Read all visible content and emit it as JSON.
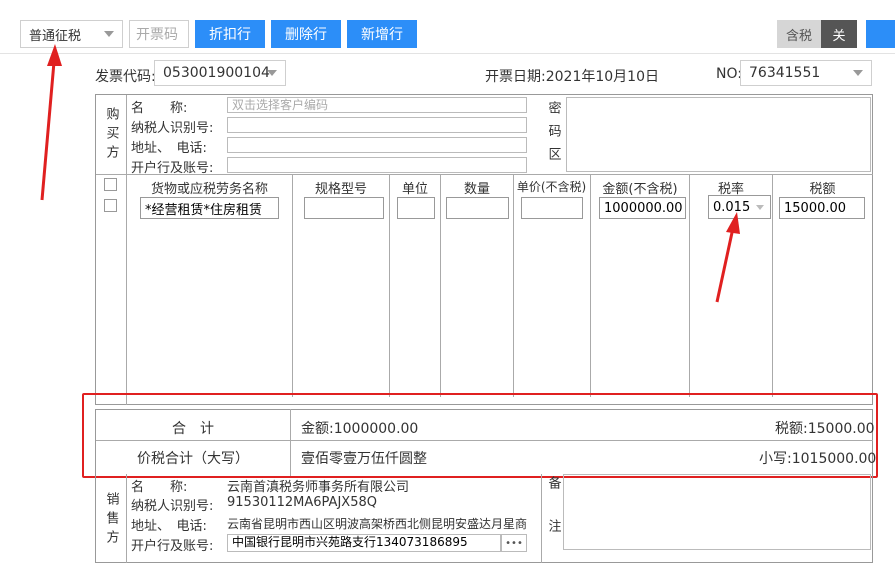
{
  "toolbar": {
    "tax_type": "普通征税",
    "invoice_code_placeholder": "开票码",
    "discount_button": "折扣行",
    "delete_row_button": "删除行",
    "add_row_button": "新增行",
    "tax_inclusive_label": "含税",
    "toggle_off_label": "关"
  },
  "header": {
    "invoice_code_label": "发票代码:",
    "invoice_code": "053001900104",
    "issue_date": "开票日期:2021年10月10日",
    "no_label": "NO:",
    "no_value": "76341551"
  },
  "buyer": {
    "section_label": "购买方",
    "name_label": "名　　称:",
    "name_placeholder": "双击选择客户编码",
    "tax_id_label": "纳税人识别号:",
    "address_label": "地址、　电话:",
    "bank_label": "开户行及账号:",
    "cipher_label": "密码区"
  },
  "items": {
    "columns": [
      "货物或应税劳务名称",
      "规格型号",
      "单位",
      "数量",
      "单价(不含税)",
      "金额(不含税)",
      "税率",
      "税额"
    ],
    "row": {
      "name": "*经营租赁*住房租赁",
      "amount": "1000000.00",
      "tax_rate": "0.015",
      "tax": "15000.00"
    }
  },
  "totals": {
    "sum_label": "合　计",
    "amount_total": "金额:1000000.00",
    "tax_total": "税额:15000.00",
    "grand_label": "价税合计（大写）",
    "grand_upper": "壹佰零壹万伍仟圆整",
    "grand_lower": "小写:1015000.00"
  },
  "seller": {
    "section_label": "销售方",
    "name_label": "名　　称:",
    "name": "云南首滇税务师事务所有限公司",
    "tax_id_label": "纳税人识别号:",
    "tax_id": "91530112MA6PAJX58Q",
    "address_label": "地址、　电话:",
    "address": "云南省昆明市西山区明波高架桥西北侧昆明安盛达月星商",
    "bank_label": "开户行及账号:",
    "bank": "中国银行昆明市兴苑路支行134073186895",
    "remark_label": "备注",
    "more_button": "•••"
  },
  "colors": {
    "accent": "#2c8ef8",
    "annotation": "#e02020"
  }
}
